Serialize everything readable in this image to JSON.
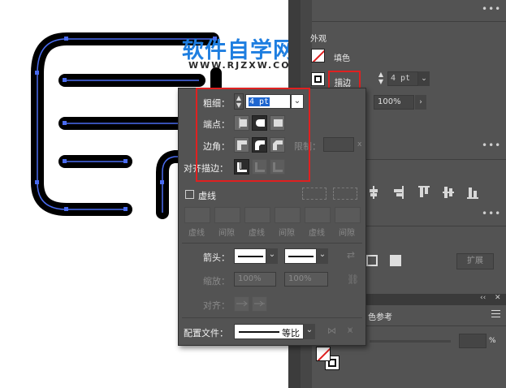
{
  "watermark": {
    "title": "软件自学网",
    "url": "WWW.RJZXW.COM"
  },
  "appearance": {
    "title": "外观",
    "fill_label": "填色",
    "stroke_button": "描边",
    "stroke_weight": "4 pt",
    "opacity": "100%",
    "percent_sign": "%"
  },
  "stroke_panel": {
    "weight_label": "粗细：",
    "weight_value": "4 pt",
    "cap_label": "端点：",
    "corner_label": "边角：",
    "limit_label": "限制：",
    "limit_suffix": "x",
    "align_label": "对齐描边：",
    "dashed_label": "虚线",
    "dash_fields": [
      {
        "label": "虚线"
      },
      {
        "label": "间隙"
      },
      {
        "label": "虚线"
      },
      {
        "label": "间隙"
      },
      {
        "label": "虚线"
      },
      {
        "label": "间隙"
      }
    ],
    "arrow_label": "箭头：",
    "scale_label": "缩放：",
    "scale_start": "100%",
    "scale_end": "100%",
    "align_arrow_label": "对齐：",
    "profile_label": "配置文件：",
    "profile_value": "等比"
  },
  "right_panel": {
    "expand_button": "扩展",
    "color_guide_tab": "色参考"
  },
  "colors": {
    "highlight": "#e02020",
    "path": "#4a6cf0",
    "panel": "#535353"
  }
}
